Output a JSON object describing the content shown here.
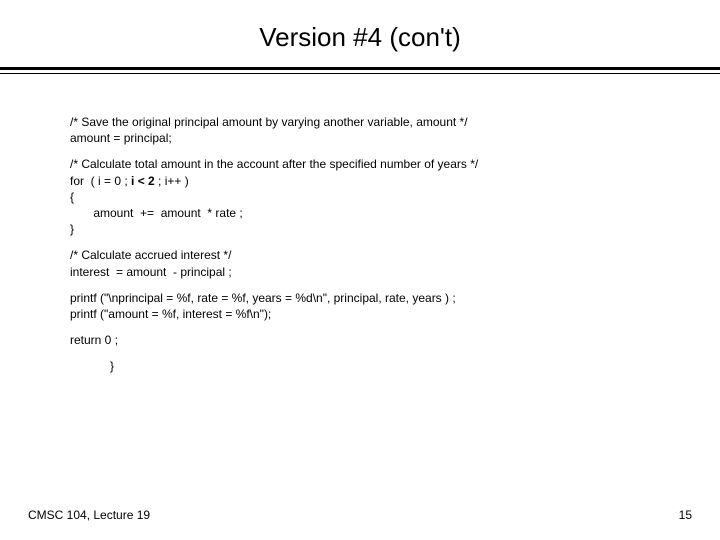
{
  "title": "Version #4 (con't)",
  "code": {
    "c1": "/* Save the original principal amount by varying another variable, amount */",
    "c2": "amount = principal;",
    "c3": "/* Calculate total amount in the account after the specified number of years */",
    "c4a": "for  ( i = 0 ; ",
    "c4b": "i < 2",
    "c4c": " ; i++ )",
    "c5": "{",
    "c6": "       amount  +=  amount  * rate ;",
    "c7": "}",
    "c8": "/* Calculate accrued interest */",
    "c9": "interest  = amount  - principal ;",
    "c10": "printf (\"\\nprincipal = %f, rate = %f, years = %d\\n\", principal, rate, years ) ;",
    "c11": "printf (\"amount = %f, interest = %f\\n\");",
    "c12": "return 0 ;",
    "c13": "}"
  },
  "footer": {
    "left": "CMSC 104, Lecture 19",
    "right": "15"
  }
}
